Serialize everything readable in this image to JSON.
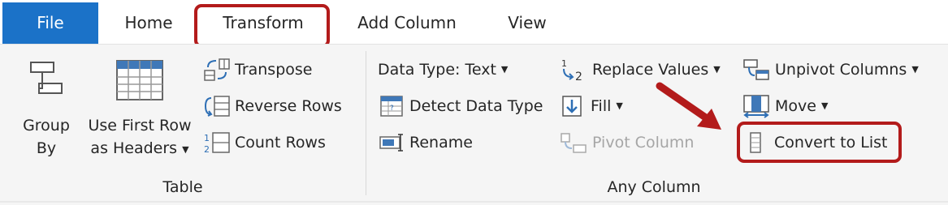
{
  "tabs": {
    "file": "File",
    "home": "Home",
    "transform": "Transform",
    "add_column": "Add Column",
    "view": "View"
  },
  "table_group": {
    "label": "Table",
    "group_by_line1": "Group",
    "group_by_line2": "By",
    "use_first_row_line1": "Use First Row",
    "use_first_row_line2": "as Headers",
    "transpose": "Transpose",
    "reverse_rows": "Reverse Rows",
    "count_rows": "Count Rows"
  },
  "any_column_group": {
    "label": "Any Column",
    "data_type": "Data Type: Text",
    "detect_data_type": "Detect Data Type",
    "rename": "Rename",
    "replace_values": "Replace Values",
    "fill": "Fill",
    "pivot_column": "Pivot Column",
    "unpivot_columns": "Unpivot Columns",
    "move": "Move",
    "convert_to_list": "Convert to List"
  },
  "colors": {
    "file_tab": "#1b72c8",
    "highlight": "#b31b1b",
    "icon_blue": "#2e6fb5"
  }
}
